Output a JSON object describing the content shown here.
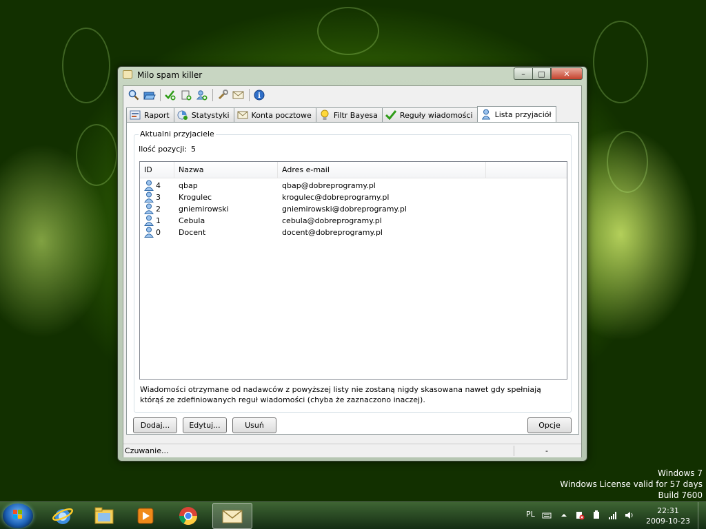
{
  "window": {
    "title": "Milo spam killer",
    "controls": {
      "minimize": "–",
      "maximize": "□",
      "close": "✕"
    }
  },
  "toolbar": {
    "icons": [
      "search-icon",
      "open-folder-icon",
      "add-green-icon",
      "add-page-icon",
      "add-user-icon",
      "tools-icon",
      "mail-icon",
      "info-icon"
    ]
  },
  "tabs": [
    {
      "label": "Raport",
      "icon": "report-icon"
    },
    {
      "label": "Statystyki",
      "icon": "stats-icon"
    },
    {
      "label": "Konta pocztowe",
      "icon": "mail-account-icon"
    },
    {
      "label": "Filtr Bayesa",
      "icon": "lightbulb-icon"
    },
    {
      "label": "Reguły wiadomości",
      "icon": "checkmark-icon"
    },
    {
      "label": "Lista przyjaciół",
      "icon": "user-icon"
    }
  ],
  "panel": {
    "group_title": "Aktualni przyjaciele",
    "count_label": "Ilość pozycji:",
    "count_value": "5",
    "columns": [
      "ID",
      "Nazwa",
      "Adres e-mail"
    ],
    "rows": [
      {
        "id": "4",
        "name": "qbap",
        "email": "qbap@dobreprogramy.pl"
      },
      {
        "id": "3",
        "name": "Krogulec",
        "email": "krogulec@dobreprogramy.pl"
      },
      {
        "id": "2",
        "name": "gniemirowski",
        "email": "gniemirowski@dobreprogramy.pl"
      },
      {
        "id": "1",
        "name": "Cebula",
        "email": "cebula@dobreprogramy.pl"
      },
      {
        "id": "0",
        "name": "Docent",
        "email": "docent@dobreprogramy.pl"
      }
    ],
    "info": "Wiadomości otrzymane od nadawców z powyższej listy nie zostaną nigdy skasowana nawet gdy spełniają którąś ze zdefiniowanych reguł wiadomości (chyba że zaznaczono inaczej)."
  },
  "buttons": {
    "add": "Dodaj...",
    "edit": "Edytuj...",
    "remove": "Usuń",
    "options": "Opcje"
  },
  "status": {
    "text": "Czuwanie...",
    "right": "-"
  },
  "watermark": {
    "line1": "Windows 7",
    "line2": "Windows License valid for 57 days",
    "line3": "Build 7600"
  },
  "taskbar": {
    "apps": [
      "internet-explorer-icon",
      "explorer-folder-icon",
      "media-player-icon",
      "chrome-icon",
      "milo-mail-icon"
    ],
    "language": "PL",
    "time": "22:31",
    "date": "2009-10-23"
  },
  "colors": {
    "desktop": "#3c7206",
    "accent_green": "#2e9c17",
    "user_icon_blue": "#4a86c8"
  }
}
